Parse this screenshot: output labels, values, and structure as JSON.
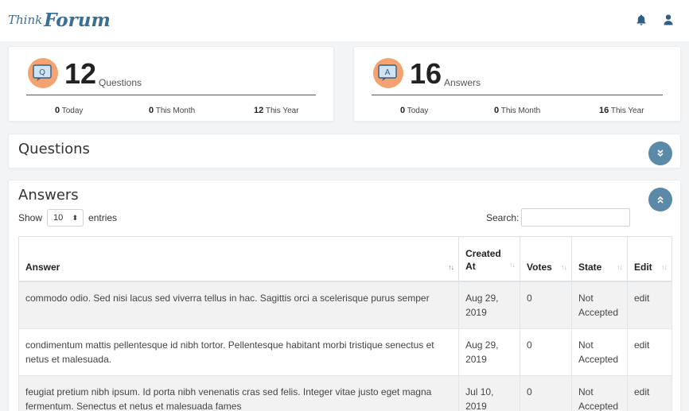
{
  "brand": {
    "think": "Think",
    "forum": "Forum"
  },
  "nav": {
    "icons": [
      "bell-icon",
      "user-icon"
    ]
  },
  "stats": [
    {
      "icon": "question-bubble-icon",
      "icon_letter": "Q",
      "count": "12",
      "label": "Questions",
      "today_value": "0",
      "today_label": "Today",
      "month_value": "0",
      "month_label": "This Month",
      "year_value": "12",
      "year_label": "This Year"
    },
    {
      "icon": "answer-bubble-icon",
      "icon_letter": "A",
      "count": "16",
      "label": "Answers",
      "today_value": "0",
      "today_label": "Today",
      "month_value": "0",
      "month_label": "This Month",
      "year_value": "16",
      "year_label": "This Year"
    }
  ],
  "questions_section": {
    "title": "Questions",
    "toggle_icon": "chevron-double-down-icon"
  },
  "answers_section": {
    "title": "Answers",
    "toggle_icon": "chevron-double-up-icon",
    "show_label": "Show",
    "entries_value": "10",
    "entries_label": "entries",
    "search_label": "Search:",
    "search_value": "",
    "columns": [
      "Answer",
      "Created At",
      "Votes",
      "State",
      "Edit"
    ],
    "rows": [
      {
        "answer": "commodo odio. Sed nisi lacus sed viverra tellus in hac. Sagittis orci a scelerisque purus semper",
        "created": "Aug 29, 2019",
        "votes": "0",
        "state": "Not Accepted",
        "edit": "edit"
      },
      {
        "answer": "condimentum mattis pellentesque id nibh tortor. Pellentesque habitant morbi tristique senectus et netus et malesuada.",
        "created": "Aug 29, 2019",
        "votes": "0",
        "state": "Not Accepted",
        "edit": "edit"
      },
      {
        "answer": "feugiat pretium nibh ipsum. Id porta nibh venenatis cras sed felis. Integer vitae justo eget magna fermentum. Senectus et netus et malesuada fames",
        "created": "Jul 10, 2019",
        "votes": "0",
        "state": "Not Accepted",
        "edit": "edit"
      }
    ]
  },
  "colors": {
    "brand": "#3b6e93",
    "icon_bg": "#f2a371",
    "toggle": "#5a8aa8",
    "row_stripe": "#f2f2f2"
  }
}
